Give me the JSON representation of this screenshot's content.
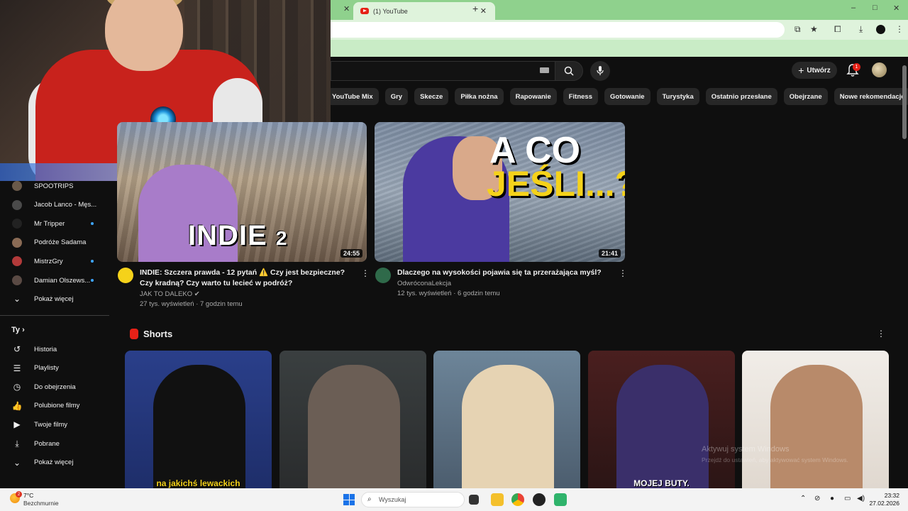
{
  "browser": {
    "tab_title": "(1) YouTube",
    "window_controls": {
      "minimize": "–",
      "maximize": "□",
      "close": "✕"
    },
    "new_tab": "+"
  },
  "youtube": {
    "create_label": "Utwórz",
    "notification_count": "1",
    "chips": [
      "YouTube Mix",
      "Gry",
      "Skecze",
      "Piłka nożna",
      "Rapowanie",
      "Fitness",
      "Gotowanie",
      "Turystyka",
      "Ostatnio przesłane",
      "Obejrzane",
      "Nowe rekomendacje"
    ],
    "sidebar": {
      "subscriptions": [
        {
          "label": "SPOOTRIPS",
          "color": "#6a5a4a",
          "dot": false
        },
        {
          "label": "Jacob Lanco - Męs...",
          "color": "#4a4a4a",
          "dot": false
        },
        {
          "label": "Mr Tripper",
          "color": "#222222",
          "dot": true
        },
        {
          "label": "Podróże Sadama",
          "color": "#8a6b55",
          "dot": false
        },
        {
          "label": "MistrzGry",
          "color": "#b23a3a",
          "dot": true
        },
        {
          "label": "Damian Olszews...",
          "color": "#5a4a44",
          "dot": true
        }
      ],
      "show_more_subs": "Pokaż więcej",
      "you_label": "Ty",
      "you_items": [
        {
          "label": "Historia",
          "icon": "history-icon",
          "glyph": "↺"
        },
        {
          "label": "Playlisty",
          "icon": "playlists-icon",
          "glyph": "☰"
        },
        {
          "label": "Do obejrzenia",
          "icon": "watch-later-icon",
          "glyph": "◷"
        },
        {
          "label": "Polubione filmy",
          "icon": "like-icon",
          "glyph": "👍"
        },
        {
          "label": "Twoje filmy",
          "icon": "your-videos-icon",
          "glyph": "▶"
        },
        {
          "label": "Pobrane",
          "icon": "downloads-icon",
          "glyph": "⤓"
        }
      ],
      "show_more_you": "Pokaż więcej"
    },
    "videos": [
      {
        "title": "INDIE: Szczera prawda - 12 pytań ⚠️ Czy jest bezpieczne? Czy kradną? Czy warto tu lecieć w podróż?",
        "channel": "JAK TO DALEKO",
        "stats": "27 tys. wyświetleń · 7 godzin temu",
        "duration": "24:55",
        "thumb_text": "INDIE",
        "thumb_text_small": "2"
      },
      {
        "title": "Dlaczego na wysokości pojawia się ta przerażająca myśl?",
        "channel": "OdwróconaLekcja",
        "stats": "12 tys. wyświetleń · 6 godzin temu",
        "duration": "21:41",
        "thumb_line1": "A CO",
        "thumb_line2": "JEŚLI...?"
      }
    ],
    "shorts_label": "Shorts",
    "shorts": [
      {
        "caption": "na jakichś lewackich"
      },
      {
        "caption": ""
      },
      {
        "caption": ""
      },
      {
        "caption": "MOJEJ BUTY."
      },
      {
        "caption": ""
      }
    ],
    "activation_watermark_1": "Aktywuj system Windows",
    "activation_watermark_2": "Przejdź do ustawień, aby aktywować system Windows."
  },
  "taskbar": {
    "temperature": "7°C",
    "condition": "Bezchmurnie",
    "weather_badge": "2",
    "search_placeholder": "Wyszukaj",
    "time": "23:32",
    "date": "27.02.2026"
  }
}
